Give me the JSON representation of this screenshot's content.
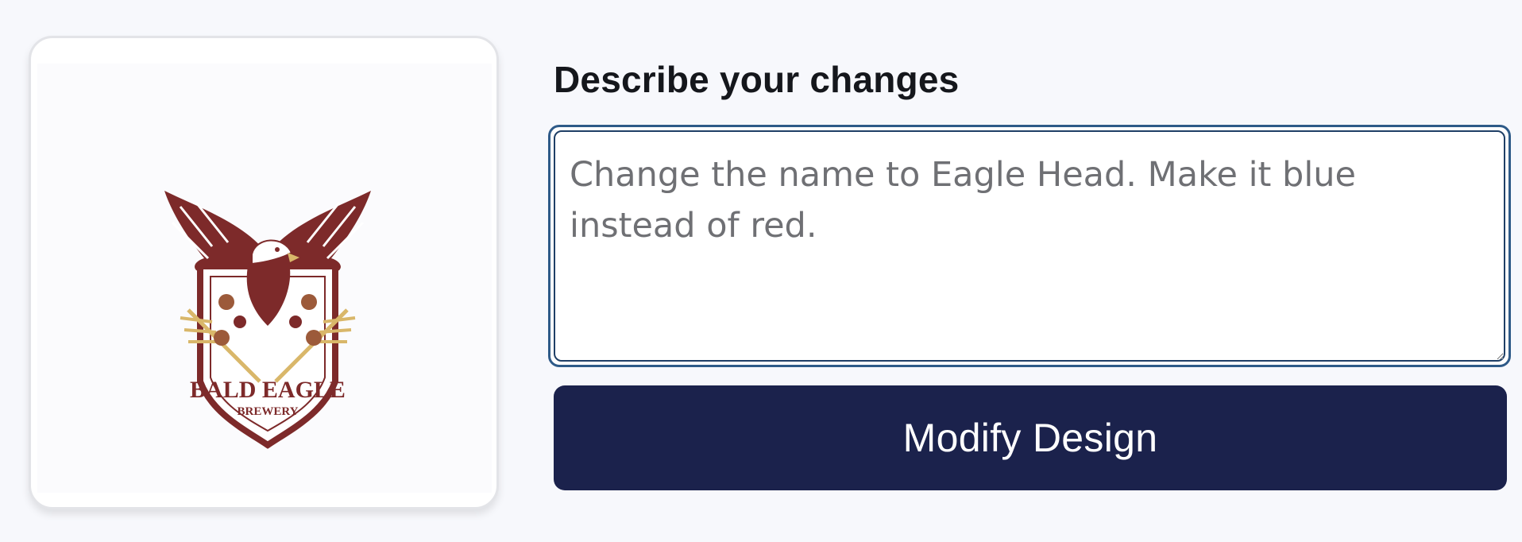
{
  "preview": {
    "logo": {
      "name_line1": "BALD EAGLE",
      "name_line2": "BREWERY",
      "primary_color": "#7d2a2a",
      "accent_color": "#d9b76a"
    }
  },
  "form": {
    "label": "Describe your changes",
    "textarea_placeholder": "Change the name to Eagle Head. Make it blue instead of red.",
    "textarea_value": "",
    "submit_label": "Modify Design"
  },
  "colors": {
    "button_bg": "#1b224c",
    "focus_ring": "#2e5a88",
    "page_bg": "#f7f8fc"
  }
}
